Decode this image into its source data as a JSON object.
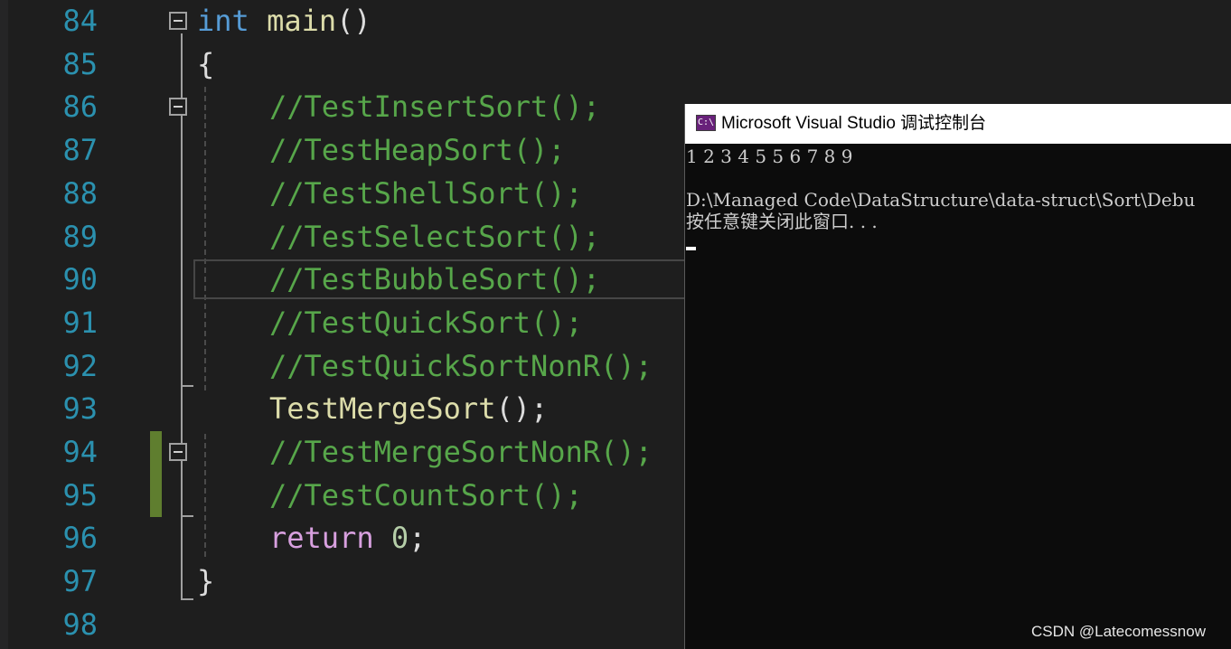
{
  "editor": {
    "lines": [
      {
        "num": "84",
        "parts": [
          [
            "kw",
            "int"
          ],
          [
            "",
            " "
          ],
          [
            "fn",
            "main"
          ],
          [
            "",
            "()"
          ]
        ]
      },
      {
        "num": "85",
        "parts": [
          [
            "",
            "{"
          ]
        ]
      },
      {
        "num": "86",
        "parts": [
          [
            "cm",
            "//TestInsertSort();"
          ]
        ]
      },
      {
        "num": "87",
        "parts": [
          [
            "cm",
            "//TestHeapSort();"
          ]
        ]
      },
      {
        "num": "88",
        "parts": [
          [
            "cm",
            "//TestShellSort();"
          ]
        ]
      },
      {
        "num": "89",
        "parts": [
          [
            "cm",
            "//TestSelectSort();"
          ]
        ]
      },
      {
        "num": "90",
        "parts": [
          [
            "cm",
            "//TestBubbleSort();"
          ]
        ]
      },
      {
        "num": "91",
        "parts": [
          [
            "cm",
            "//TestQuickSort();"
          ]
        ]
      },
      {
        "num": "92",
        "parts": [
          [
            "cm",
            "//TestQuickSortNonR();"
          ]
        ]
      },
      {
        "num": "93",
        "parts": [
          [
            "fn",
            "TestMergeSort"
          ],
          [
            "",
            "();"
          ]
        ]
      },
      {
        "num": "94",
        "parts": [
          [
            "cm",
            "//TestMergeSortNonR();"
          ]
        ]
      },
      {
        "num": "95",
        "parts": [
          [
            "cm",
            "//TestCountSort();"
          ]
        ]
      },
      {
        "num": "96",
        "parts": [
          [
            "ret",
            "return"
          ],
          [
            "",
            " "
          ],
          [
            "num",
            "0"
          ],
          [
            "",
            ";"
          ]
        ]
      },
      {
        "num": "97",
        "parts": [
          [
            "",
            "}"
          ]
        ]
      },
      {
        "num": "98",
        "parts": []
      }
    ],
    "colors": {
      "line_number": "#2b91af",
      "keyword": "#569cd6",
      "function": "#dcdcaa",
      "comment": "#57a64a",
      "control": "#d8a0df",
      "number": "#b5cea8",
      "changed_bar": "#5f7e2f"
    }
  },
  "console": {
    "icon": "vs-debug-console-icon",
    "icon_text": "C:\\",
    "title": "Microsoft Visual Studio 调试控制台",
    "output": [
      "1 2 3 4 5 5 6 7 8 9",
      "",
      "D:\\Managed Code\\DataStructure\\data-struct\\Sort\\Debu",
      "按任意键关闭此窗口. . ."
    ]
  },
  "watermark": "CSDN @Latecomessnow"
}
